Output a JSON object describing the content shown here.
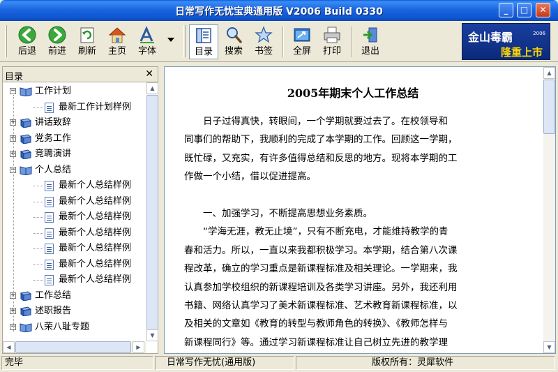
{
  "window": {
    "title": "日常写作无忧宝典通用版 V2006 Build 0330",
    "minimize": "_",
    "maximize": "□",
    "close": "✕"
  },
  "toolbar": {
    "buttons": [
      {
        "label": "后退",
        "icon": "back-arrow-icon"
      },
      {
        "label": "前进",
        "icon": "forward-arrow-icon"
      },
      {
        "label": "刷新",
        "icon": "refresh-icon"
      },
      {
        "label": "主页",
        "icon": "home-icon"
      },
      {
        "label": "字体",
        "icon": "font-icon"
      },
      {
        "label": "目录",
        "icon": "contents-icon"
      },
      {
        "label": "搜索",
        "icon": "search-icon"
      },
      {
        "label": "书签",
        "icon": "bookmark-star-icon"
      },
      {
        "label": "全屏",
        "icon": "fullscreen-icon"
      },
      {
        "label": "打印",
        "icon": "printer-icon"
      },
      {
        "label": "退出",
        "icon": "exit-icon"
      }
    ],
    "banner": {
      "line1": "金山毒霸",
      "line2": "隆重上市",
      "tag": "2006"
    }
  },
  "sidebar": {
    "title": "目录",
    "close": "✕",
    "items": [
      {
        "label": "工作计划",
        "level": 0,
        "expanded": true
      },
      {
        "label": "最新工作计划样例",
        "level": 1
      },
      {
        "label": "讲话致辞",
        "level": 0,
        "expanded": false
      },
      {
        "label": "党务工作",
        "level": 0,
        "expanded": false
      },
      {
        "label": "竞聘演讲",
        "level": 0,
        "expanded": false
      },
      {
        "label": "个人总结",
        "level": 0,
        "expanded": true
      },
      {
        "label": "最新个人总结样例",
        "level": 1
      },
      {
        "label": "最新个人总结样例",
        "level": 1
      },
      {
        "label": "最新个人总结样例",
        "level": 1
      },
      {
        "label": "最新个人总结样例",
        "level": 1
      },
      {
        "label": "最新个人总结样例",
        "level": 1
      },
      {
        "label": "最新个人总结样例",
        "level": 1
      },
      {
        "label": "最新个人总结样例",
        "level": 1
      },
      {
        "label": "工作总结",
        "level": 0,
        "expanded": false
      },
      {
        "label": "述职报告",
        "level": 0,
        "expanded": false
      },
      {
        "label": "八荣八耻专题",
        "level": 0,
        "expanded": true
      }
    ]
  },
  "document": {
    "title": "2005年期末个人工作总结",
    "lines": [
      "　　日子过得真快，转眼间，一个学期就要过去了。在校领导和",
      "同事们的帮助下，我顺利的完成了本学期的工作。回顾这一学期，",
      "既忙碌，又充实，有许多值得总结和反思的地方。现将本学期的工",
      "作做一个小结，借以促进提高。",
      "",
      "　　一、加强学习，不断提高思想业务素质。",
      "　　“学海无涯，教无止境”，只有不断充电，才能维持教学的青",
      "春和活力。所以，一直以来我都积极学习。本学期，结合第八次课",
      "程改革，确立的学习重点是新课程标准及相关理论。一学期来，我",
      "认真参加学校组织的新课程培训及各类学习讲座。另外，我还利用",
      "书籍、网络认真学习了美术新课程标准、艺术教育新课程标准，以",
      "及相关的文章如《教育的转型与教师角色的转换》、《教师怎样与",
      "新课程同行》等。通过学习新课程标准让自己树立先进的教学理"
    ]
  },
  "status": {
    "state": "完毕",
    "product": "日常写作无忧(通用版)",
    "copyright": "版权所有：灵犀软件"
  }
}
